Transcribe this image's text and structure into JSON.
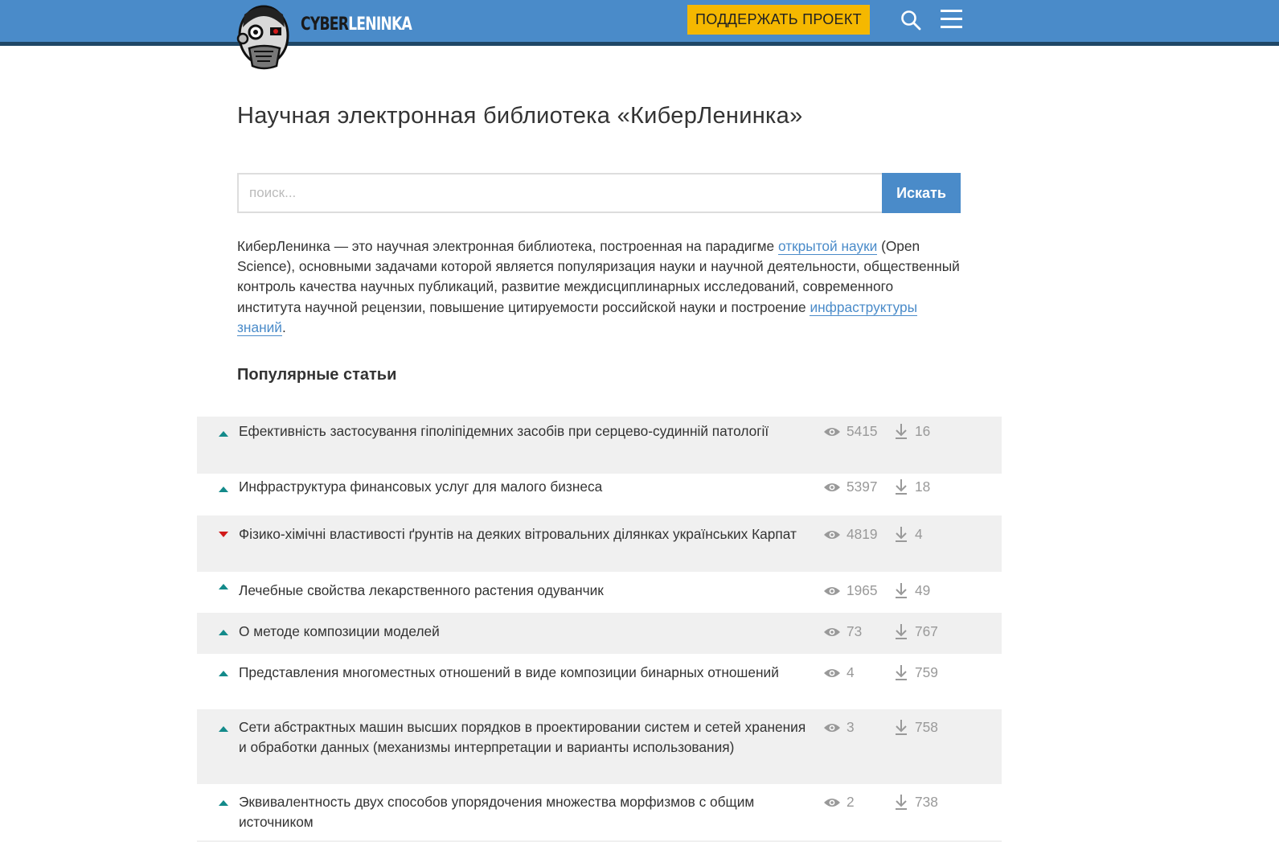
{
  "header": {
    "logo_cyber": "CYBER",
    "logo_leninka": "LENINKA",
    "donate_label": "ПОДДЕРЖАТЬ ПРОЕКТ",
    "search_icon": "search-icon",
    "menu_icon": "hamburger-menu-icon"
  },
  "page_title": "Научная электронная библиотека «КиберЛенинка»",
  "search": {
    "placeholder": "поиск...",
    "value": "",
    "button_label": "Искать"
  },
  "intro": {
    "part1": "КиберЛенинка — это научная электронная библиотека, построенная на парадигме ",
    "link1": "открытой науки",
    "part2": " (Open Science), основными задачами которой является популяризация науки и научной деятельности, общественный контроль качества научных публикаций, развитие междисциплинарных исследований, современного института научной рецензии, повышение цитируемости российской науки и построение ",
    "link2": "инфраструктуры знаний",
    "part3": "."
  },
  "popular": {
    "heading": "Популярные статьи",
    "articles": [
      {
        "trend": "up",
        "title": "Ефективність застосування гіполіпідемних засобів при серцево-судинній патології",
        "views": "5415",
        "downloads": "16"
      },
      {
        "trend": "up",
        "title": "Инфраструктура финансовых услуг для малого бизнеса",
        "views": "5397",
        "downloads": "18"
      },
      {
        "trend": "down",
        "title": "Фізико-хімічні властивості ґрунтів на деяких вітровальних ділянках українських Карпат",
        "views": "4819",
        "downloads": "4"
      },
      {
        "trend": "up",
        "title": "Лечебные свойства лекарственного растения одуванчик",
        "views": "1965",
        "downloads": "49"
      },
      {
        "trend": "up",
        "title": "О методе композиции моделей",
        "views": "73",
        "downloads": "767"
      },
      {
        "trend": "up",
        "title": "Представления многоместных отношений в виде композиции бинарных отношений",
        "views": "4",
        "downloads": "759"
      },
      {
        "trend": "up",
        "title": "Сети абстрактных машин высших порядков в проектировании систем и сетей хранения и обработки данных (механизмы интерпретации и варианты использования)",
        "views": "3",
        "downloads": "758"
      },
      {
        "trend": "up",
        "title": "Эквивалентность двух способов упорядочения множества морфизмов с  общим источником",
        "views": "2",
        "downloads": "738"
      }
    ]
  },
  "colors": {
    "header_bg": "#4a8bc9",
    "header_border": "#1f4766",
    "donate_bg": "#f5b800",
    "trend_up": "#138a8a",
    "trend_down": "#d11a1a",
    "row_shade": "#f0f0f0",
    "link": "#4a8bc9"
  }
}
